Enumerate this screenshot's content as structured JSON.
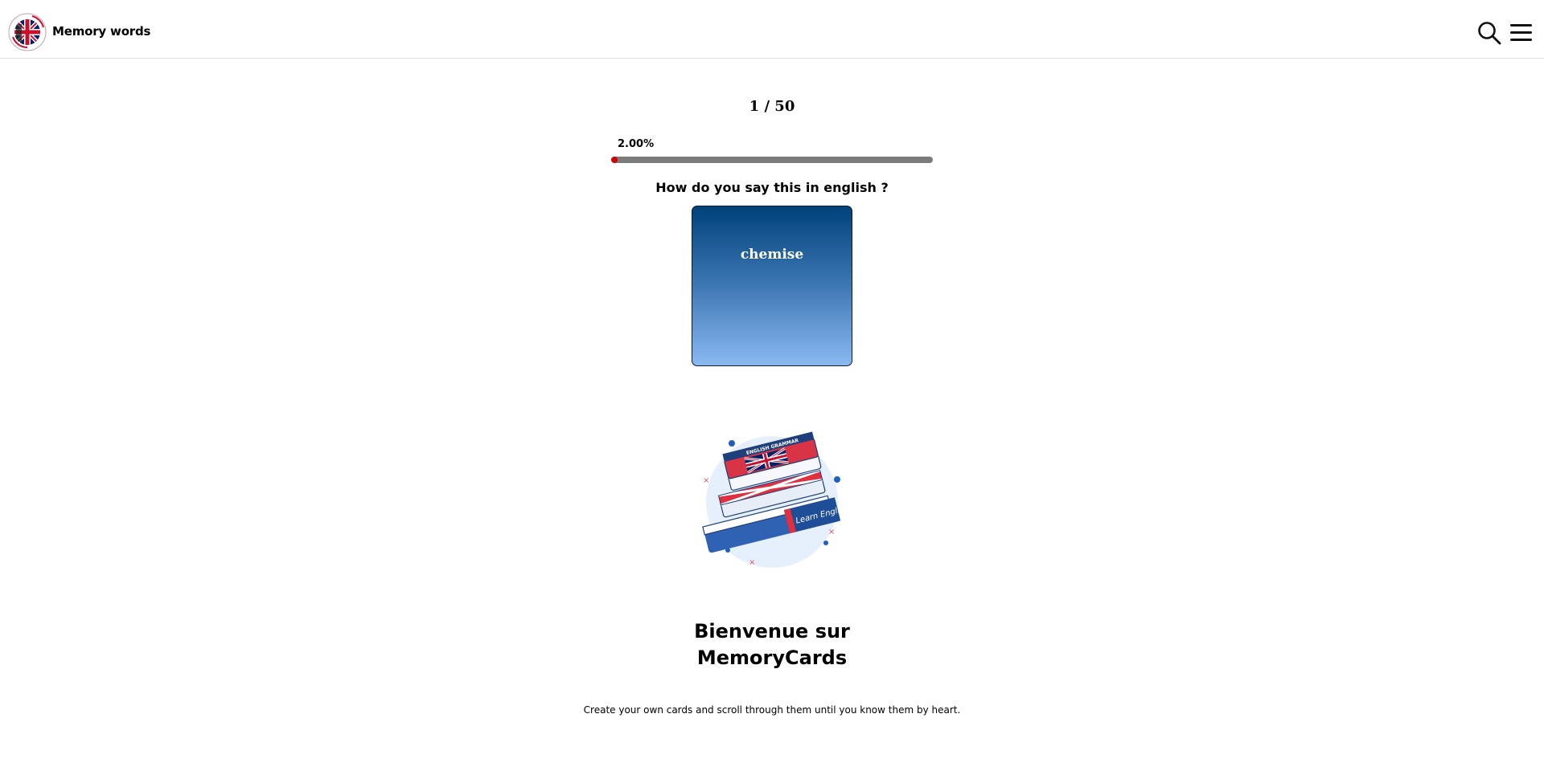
{
  "header": {
    "app_title": "Memory words",
    "logo_icon": "london-union-jack-logo",
    "search_icon": "search-icon",
    "menu_icon": "hamburger-menu-icon"
  },
  "progress": {
    "counter": "1 / 50",
    "percent_label": "2.00%",
    "fraction": 0.02,
    "fill_color": "#d50000",
    "track_color": "#7b7b7b"
  },
  "quiz": {
    "question": "How do you say this in english ?",
    "card_word": "chemise",
    "card_gradient_top": "#00417a",
    "card_gradient_bottom": "#8ab9f1"
  },
  "welcome": {
    "line1": "Bienvenue sur",
    "line2": "MemoryCards",
    "subtitle": "Create your own cards and scroll through them until you know them by heart.",
    "illustration_icon": "books-learn-english-illustration",
    "illustration_text_top": "ENGLISH GRAMMAR",
    "illustration_text_spine": "Learn English"
  }
}
